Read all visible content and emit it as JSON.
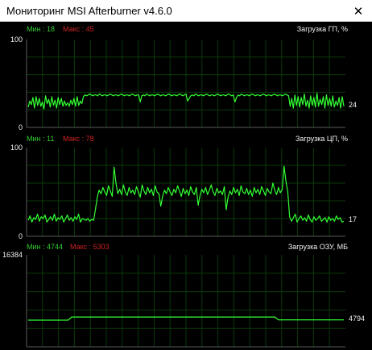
{
  "window": {
    "title": "Мониторинг MSI Afterburner v4.6.0",
    "close_glyph": "✕"
  },
  "colors": {
    "background": "#000000",
    "grid": "#0a3a0a",
    "axis": "#5a5a5a",
    "trace": "#33ff33",
    "min_text": "#33cc33",
    "max_text": "#cc2222"
  },
  "graphs": [
    {
      "id": "gpu",
      "label": "Загрузка ГП, %",
      "min_text": "Мин : 18",
      "max_text": "Макс : 45",
      "y_max_label": "100",
      "y_min_label": "0",
      "y_range": [
        0,
        100
      ],
      "current_value": "24",
      "samples": [
        23,
        30,
        26,
        34,
        22,
        35,
        25,
        33,
        24,
        29,
        21,
        36,
        27,
        32,
        23,
        35,
        25,
        31,
        22,
        34,
        26,
        33,
        24,
        30,
        25,
        28,
        24,
        31,
        26,
        33,
        24,
        35,
        25,
        30,
        27,
        35,
        37,
        36,
        37,
        38,
        37,
        36,
        37,
        37,
        36,
        38,
        37,
        36,
        37,
        37,
        36,
        37,
        38,
        37,
        36,
        37,
        37,
        36,
        37,
        38,
        37,
        36,
        37,
        37,
        36,
        37,
        38,
        37,
        36,
        37,
        37,
        29,
        36,
        37,
        36,
        38,
        37,
        36,
        37,
        37,
        36,
        37,
        38,
        37,
        36,
        37,
        37,
        36,
        37,
        38,
        37,
        36,
        37,
        37,
        36,
        37,
        38,
        37,
        36,
        37,
        38,
        30,
        33,
        36,
        37,
        36,
        38,
        37,
        36,
        37,
        37,
        36,
        37,
        38,
        37,
        36,
        37,
        37,
        36,
        37,
        38,
        37,
        36,
        37,
        37,
        36,
        37,
        38,
        37,
        36,
        37,
        29,
        34,
        37,
        36,
        38,
        37,
        36,
        37,
        37,
        36,
        37,
        38,
        37,
        36,
        37,
        37,
        36,
        37,
        38,
        37,
        36,
        37,
        37,
        36,
        37,
        38,
        37,
        36,
        37,
        37,
        36,
        37,
        38,
        37,
        36,
        24,
        33,
        22,
        37,
        25,
        35,
        23,
        34,
        26,
        38,
        24,
        31,
        22,
        36,
        25,
        34,
        23,
        39,
        24,
        32,
        26,
        35,
        22,
        37,
        25,
        33,
        24,
        36,
        23,
        30,
        25,
        34,
        22,
        35,
        24
      ]
    },
    {
      "id": "cpu",
      "label": "Загрузка ЦП, %",
      "min_text": "Мин : 11",
      "max_text": "Макс : 78",
      "y_max_label": "100",
      "y_min_label": "0",
      "y_range": [
        0,
        100
      ],
      "current_value": "17",
      "samples": [
        18,
        23,
        16,
        21,
        19,
        25,
        17,
        22,
        20,
        24,
        16,
        19,
        22,
        18,
        25,
        17,
        21,
        19,
        23,
        16,
        20,
        24,
        18,
        21,
        17,
        22,
        19,
        25,
        16,
        20,
        19,
        18,
        20,
        17,
        19,
        18,
        30,
        44,
        52,
        48,
        55,
        50,
        46,
        57,
        51,
        45,
        78,
        60,
        48,
        53,
        47,
        58,
        50,
        46,
        55,
        49,
        52,
        47,
        56,
        50,
        44,
        58,
        51,
        47,
        55,
        49,
        53,
        46,
        57,
        50,
        48,
        34,
        45,
        52,
        48,
        55,
        50,
        46,
        53,
        49,
        57,
        51,
        45,
        54,
        48,
        52,
        46,
        56,
        50,
        47,
        55,
        35,
        46,
        53,
        49,
        55,
        47,
        52,
        58,
        50,
        46,
        54,
        49,
        51,
        47,
        56,
        30,
        44,
        51,
        47,
        55,
        49,
        53,
        46,
        57,
        50,
        48,
        54,
        47,
        52,
        45,
        55,
        49,
        53,
        47,
        56,
        51,
        46,
        54,
        50,
        48,
        60,
        52,
        47,
        55,
        49,
        53,
        79,
        62,
        50,
        22,
        17,
        21,
        25,
        16,
        20,
        23,
        18,
        21,
        17,
        24,
        19,
        16,
        22,
        18,
        20,
        23,
        17,
        19,
        21,
        16,
        22,
        18,
        20,
        17,
        23,
        19,
        21,
        16,
        17
      ]
    },
    {
      "id": "ram",
      "label": "Загрузка ОЗУ, МБ",
      "min_text": "Мин : 4744",
      "max_text": "Макс : 5303",
      "y_max_label": "16384",
      "y_min_label": "",
      "y_range": [
        0,
        16384
      ],
      "current_value": "4794",
      "samples": [
        4744,
        4744,
        4744,
        4744,
        4744,
        4744,
        4744,
        4744,
        4744,
        4744,
        4744,
        4744,
        5303,
        5303,
        5303,
        5303,
        5303,
        5303,
        5303,
        5303,
        5303,
        5303,
        5303,
        5303,
        5303,
        5303,
        5303,
        5303,
        5303,
        5303,
        5303,
        5303,
        5303,
        5303,
        5303,
        5303,
        5303,
        5303,
        5303,
        5303,
        5303,
        5303,
        5303,
        5303,
        5303,
        5303,
        5303,
        5303,
        5303,
        5303,
        5303,
        5303,
        5303,
        5303,
        5303,
        5303,
        5303,
        5303,
        5303,
        5303,
        5303,
        5303,
        5303,
        5303,
        5303,
        5303,
        5303,
        5303,
        5303,
        4794,
        4794,
        4794,
        4794,
        4794,
        4794,
        4794,
        4794,
        4794,
        4794,
        4794,
        4794,
        4794,
        4794,
        4794,
        4794,
        4794,
        4794,
        4794
      ]
    }
  ]
}
